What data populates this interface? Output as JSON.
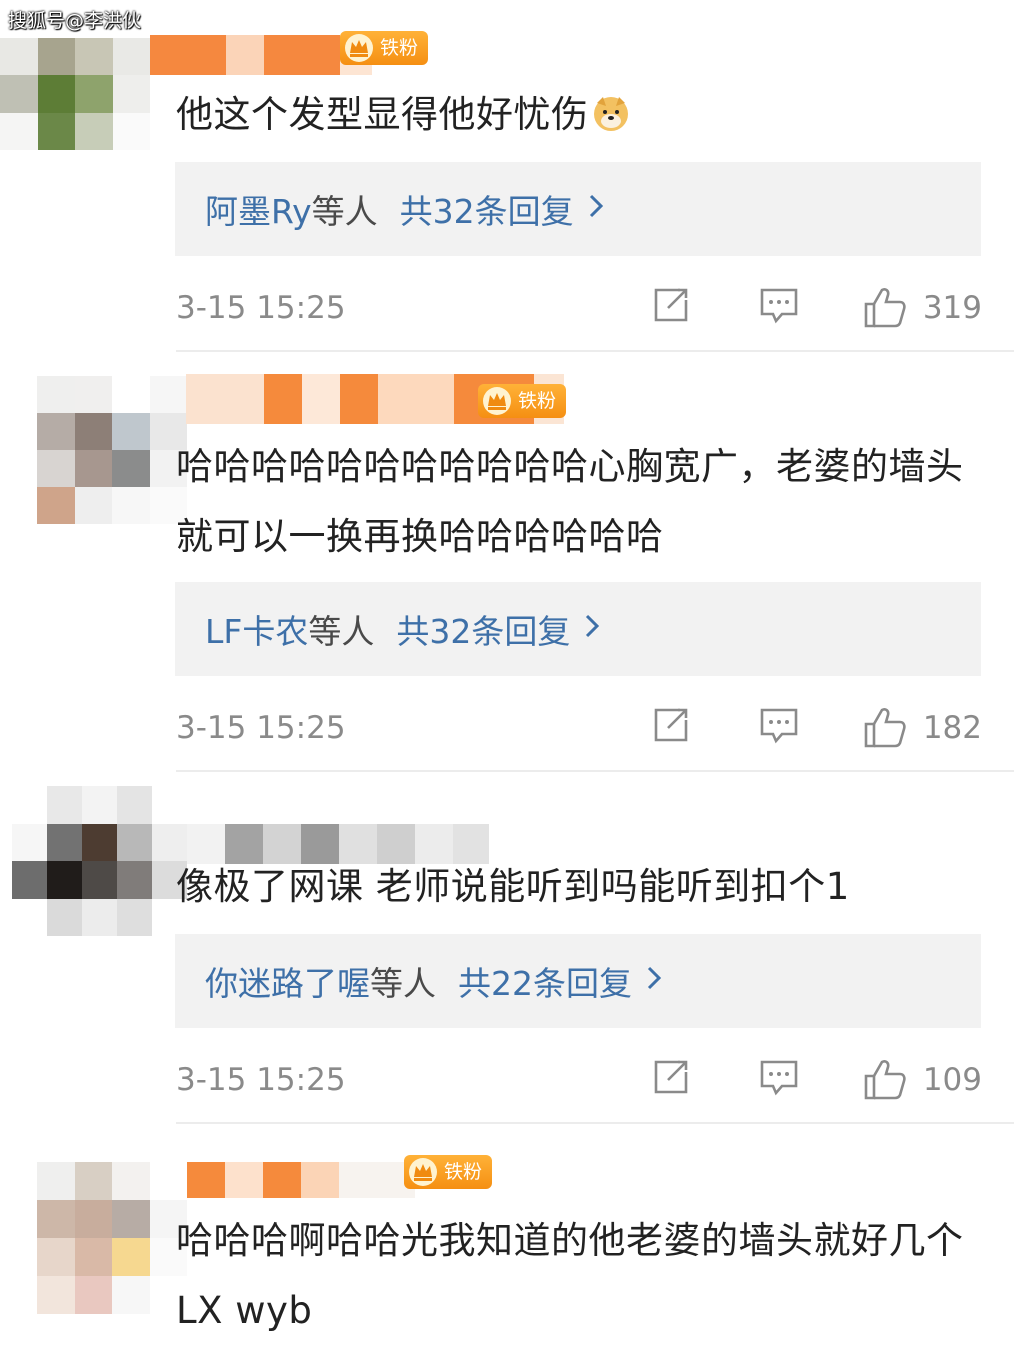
{
  "watermark": "搜狐号@李洪伙",
  "badge_label": "铁粉",
  "comments": [
    {
      "text": "他这个发型显得他好忧伤",
      "emoji": "doge-emoji",
      "reply_users": "阿墨Ry",
      "reply_users_suffix": "等人",
      "reply_count_text": "共32条回复",
      "time": "3-15 15:25",
      "likes": "319"
    },
    {
      "text": "哈哈哈哈哈哈哈哈哈哈哈心胸宽广，老婆的墙头就可以一换再换哈哈哈哈哈哈",
      "reply_users": "LF卡农",
      "reply_users_suffix": "等人",
      "reply_count_text": "共32条回复",
      "time": "3-15 15:25",
      "likes": "182"
    },
    {
      "text": "像极了网课 老师说能听到吗能听到扣个1",
      "reply_users": "你迷路了喔",
      "reply_users_suffix": "等人",
      "reply_count_text": "共22条回复",
      "time": "3-15 15:25",
      "likes": "109"
    },
    {
      "text": "哈哈哈啊哈哈光我知道的他老婆的墙头就好几个LX wyb"
    }
  ],
  "icons": {
    "repost": "repost-icon",
    "comment": "comment-icon",
    "like": "thumbs-up-icon",
    "chevron": "chevron-right-icon",
    "badge": "crown-icon"
  },
  "colors": {
    "link": "#3e70a8",
    "muted": "#8a8a8a",
    "reply_bg": "#f2f2f2",
    "badge": "#f59a1c"
  }
}
